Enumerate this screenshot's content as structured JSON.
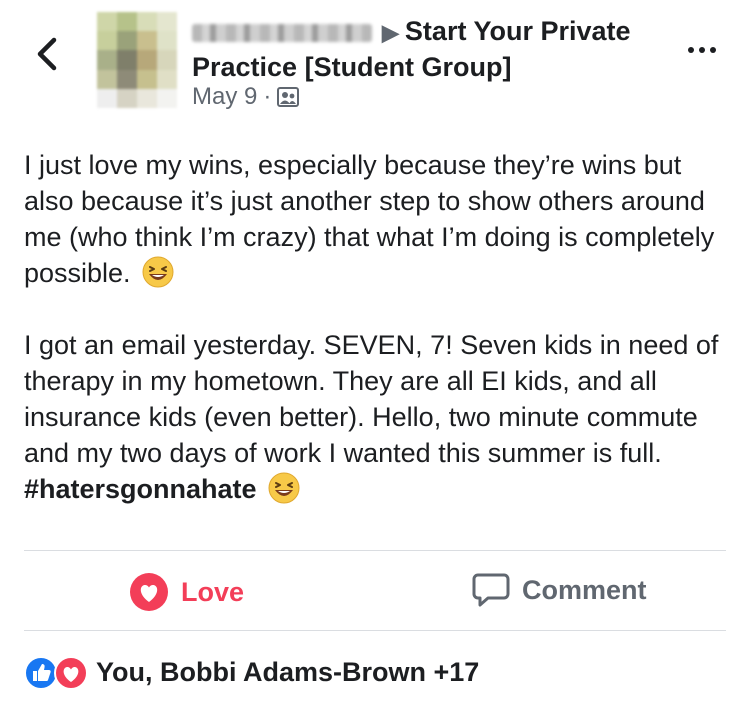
{
  "header": {
    "group_name": "Start Your Private Practice [Student Group]",
    "date": "May 9",
    "separator": "·"
  },
  "post": {
    "paragraph1": "I just love my wins, especially because they’re wins but also because it’s just another step to show others around me (who think I’m crazy) that what I’m doing is completely possible.",
    "paragraph2_text": "I got an email yesterday. SEVEN, 7! Seven kids in need of therapy in my hometown. They are all EI kids, and all insurance kids (even better). Hello, two minute commute and my two days of work I wanted this summer is full.",
    "hashtag": "#hatersgonnahate",
    "emoji": "laughing-face"
  },
  "actions": {
    "love_label": "Love",
    "comment_label": "Comment"
  },
  "reactions": {
    "summary": "You, Bobbi Adams-Brown +17",
    "types": [
      "like",
      "love"
    ]
  },
  "colors": {
    "love": "#f33e58",
    "like": "#1877f2",
    "secondary_text": "#606770"
  }
}
